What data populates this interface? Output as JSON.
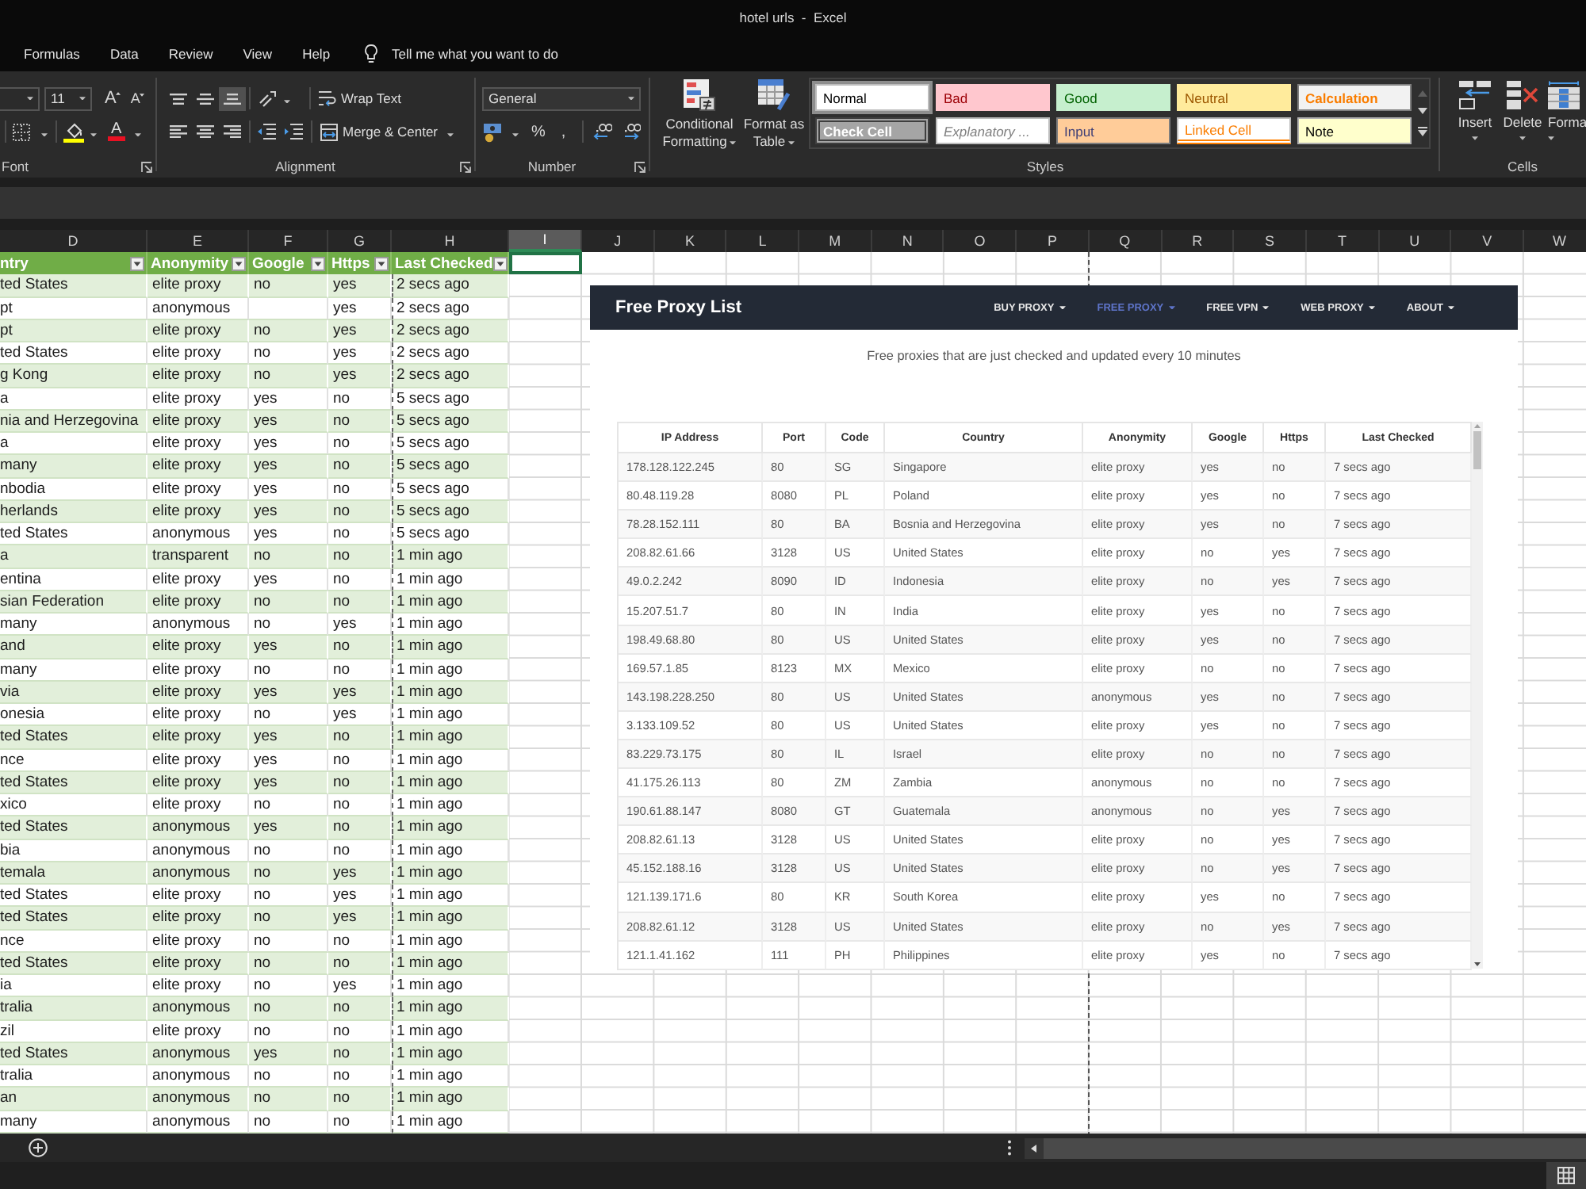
{
  "window": {
    "title": "hotel urls  -  Excel"
  },
  "ribbon": {
    "tabs": [
      "Formulas",
      "Data",
      "Review",
      "View",
      "Help"
    ],
    "tell_me": "Tell me what you want to do",
    "font": {
      "size": "11",
      "grow": "A",
      "shrink": "A",
      "font_color": "A",
      "label": "Font"
    },
    "alignment": {
      "buttons": [
        {
          "kind": "top",
          "selected": false
        },
        {
          "kind": "middle",
          "selected": false
        },
        {
          "kind": "bottom",
          "selected": true
        },
        {
          "kind": "left",
          "selected": false
        },
        {
          "kind": "center",
          "selected": false
        },
        {
          "kind": "right",
          "selected": false
        }
      ],
      "wrap_text": "Wrap Text",
      "merge": "Merge & Center",
      "label": "Alignment"
    },
    "number": {
      "format": "General",
      "percent": "%",
      "comma": ",",
      "label": "Number"
    },
    "styles": {
      "conditional_formatting": "Conditional Formatting",
      "format_as_table": "Format as Table",
      "gallery": [
        {
          "label": "Normal",
          "kind": "normal",
          "selected": true
        },
        {
          "label": "Bad",
          "kind": "bad",
          "selected": false
        },
        {
          "label": "Good",
          "kind": "good",
          "selected": false
        },
        {
          "label": "Neutral",
          "kind": "neutral",
          "selected": false
        },
        {
          "label": "Calculation",
          "kind": "calculation",
          "selected": false
        },
        {
          "label": "Check Cell",
          "kind": "check",
          "selected": false
        },
        {
          "label": "Explanatory ...",
          "kind": "explanatory",
          "selected": false
        },
        {
          "label": "Input",
          "kind": "input",
          "selected": false
        },
        {
          "label": "Linked Cell",
          "kind": "linked",
          "selected": false
        },
        {
          "label": "Note",
          "kind": "note",
          "selected": false
        }
      ],
      "label": "Styles"
    },
    "cells": {
      "buttons": [
        {
          "kind": "insert",
          "label": "Insert"
        },
        {
          "kind": "delete",
          "label": "Delete"
        },
        {
          "kind": "format",
          "label": "Forma"
        }
      ],
      "label": "Cells"
    }
  },
  "sheet": {
    "columns": [
      {
        "label": "D",
        "selected": false
      },
      {
        "label": "E",
        "selected": false
      },
      {
        "label": "F",
        "selected": false
      },
      {
        "label": "G",
        "selected": false
      },
      {
        "label": "H",
        "selected": false
      },
      {
        "label": "I",
        "selected": true
      },
      {
        "label": "J",
        "selected": false
      },
      {
        "label": "K",
        "selected": false
      },
      {
        "label": "L",
        "selected": false
      },
      {
        "label": "M",
        "selected": false
      },
      {
        "label": "N",
        "selected": false
      },
      {
        "label": "O",
        "selected": false
      },
      {
        "label": "P",
        "selected": false
      },
      {
        "label": "Q",
        "selected": false
      },
      {
        "label": "R",
        "selected": false
      },
      {
        "label": "S",
        "selected": false
      },
      {
        "label": "T",
        "selected": false
      },
      {
        "label": "U",
        "selected": false
      },
      {
        "label": "V",
        "selected": false
      },
      {
        "label": "W",
        "selected": false
      }
    ],
    "table": {
      "headers": [
        "ntry",
        "Anonymity",
        "Google",
        "Https",
        "Last Checked"
      ],
      "rows": [
        [
          "ted States",
          "elite proxy",
          "no",
          "yes",
          "2 secs ago"
        ],
        [
          "pt",
          "anonymous",
          null,
          "yes",
          "2 secs ago"
        ],
        [
          "pt",
          "elite proxy",
          "no",
          "yes",
          "2 secs ago"
        ],
        [
          "ted States",
          "elite proxy",
          "no",
          "yes",
          "2 secs ago"
        ],
        [
          "g Kong",
          "elite proxy",
          "no",
          "yes",
          "2 secs ago"
        ],
        [
          "a",
          "elite proxy",
          "yes",
          "no",
          "5 secs ago"
        ],
        [
          "nia and Herzegovina",
          "elite proxy",
          "yes",
          "no",
          "5 secs ago"
        ],
        [
          "a",
          "elite proxy",
          "yes",
          "no",
          "5 secs ago"
        ],
        [
          "many",
          "elite proxy",
          "yes",
          "no",
          "5 secs ago"
        ],
        [
          "nbodia",
          "elite proxy",
          "yes",
          "no",
          "5 secs ago"
        ],
        [
          "herlands",
          "elite proxy",
          "yes",
          "no",
          "5 secs ago"
        ],
        [
          "ted States",
          "anonymous",
          "yes",
          "no",
          "5 secs ago"
        ],
        [
          "a",
          "transparent",
          "no",
          "no",
          "1 min ago"
        ],
        [
          "entina",
          "elite proxy",
          "yes",
          "no",
          "1 min ago"
        ],
        [
          "sian Federation",
          "elite proxy",
          "no",
          "no",
          "1 min ago"
        ],
        [
          "many",
          "anonymous",
          "no",
          "yes",
          "1 min ago"
        ],
        [
          "and",
          "elite proxy",
          "yes",
          "no",
          "1 min ago"
        ],
        [
          "many",
          "elite proxy",
          "no",
          "no",
          "1 min ago"
        ],
        [
          "via",
          "elite proxy",
          "yes",
          "yes",
          "1 min ago"
        ],
        [
          "onesia",
          "elite proxy",
          "no",
          "yes",
          "1 min ago"
        ],
        [
          "ted States",
          "elite proxy",
          "yes",
          "no",
          "1 min ago"
        ],
        [
          "nce",
          "elite proxy",
          "yes",
          "no",
          "1 min ago"
        ],
        [
          "ted States",
          "elite proxy",
          "yes",
          "no",
          "1 min ago"
        ],
        [
          "xico",
          "elite proxy",
          "no",
          "no",
          "1 min ago"
        ],
        [
          "ted States",
          "anonymous",
          "yes",
          "no",
          "1 min ago"
        ],
        [
          "bia",
          "anonymous",
          "no",
          "no",
          "1 min ago"
        ],
        [
          "temala",
          "anonymous",
          "no",
          "yes",
          "1 min ago"
        ],
        [
          "ted States",
          "elite proxy",
          "no",
          "yes",
          "1 min ago"
        ],
        [
          "ted States",
          "elite proxy",
          "no",
          "yes",
          "1 min ago"
        ],
        [
          "nce",
          "elite proxy",
          "no",
          "no",
          "1 min ago"
        ],
        [
          "ted States",
          "elite proxy",
          "no",
          "no",
          "1 min ago"
        ],
        [
          "ia",
          "elite proxy",
          "no",
          "yes",
          "1 min ago"
        ],
        [
          "tralia",
          "anonymous",
          "no",
          "no",
          "1 min ago"
        ],
        [
          "zil",
          "elite proxy",
          "no",
          "no",
          "1 min ago"
        ],
        [
          "ted States",
          "anonymous",
          "yes",
          "no",
          "1 min ago"
        ],
        [
          "tralia",
          "anonymous",
          "no",
          "no",
          "1 min ago"
        ],
        [
          "an",
          "anonymous",
          "no",
          "no",
          "1 min ago"
        ],
        [
          "many",
          "anonymous",
          "no",
          "no",
          "1 min ago"
        ]
      ]
    }
  },
  "web_page": {
    "brand": "Free Proxy List",
    "nav": [
      {
        "label": "BUY PROXY",
        "selected": false
      },
      {
        "label": "FREE PROXY",
        "selected": true
      },
      {
        "label": "FREE VPN",
        "selected": false
      },
      {
        "label": "WEB PROXY",
        "selected": false
      },
      {
        "label": "ABOUT",
        "selected": false
      }
    ],
    "subtitle": "Free proxies that are just checked and updated every 10 minutes",
    "table": {
      "columns": [
        "IP Address",
        "Port",
        "Code",
        "Country",
        "Anonymity",
        "Google",
        "Https",
        "Last Checked"
      ],
      "rows": [
        [
          "178.128.122.245",
          "80",
          "SG",
          "Singapore",
          "elite proxy",
          "yes",
          "no",
          "7 secs ago"
        ],
        [
          "80.48.119.28",
          "8080",
          "PL",
          "Poland",
          "elite proxy",
          "yes",
          "no",
          "7 secs ago"
        ],
        [
          "78.28.152.111",
          "80",
          "BA",
          "Bosnia and Herzegovina",
          "elite proxy",
          "yes",
          "no",
          "7 secs ago"
        ],
        [
          "208.82.61.66",
          "3128",
          "US",
          "United States",
          "elite proxy",
          "no",
          "yes",
          "7 secs ago"
        ],
        [
          "49.0.2.242",
          "8090",
          "ID",
          "Indonesia",
          "elite proxy",
          "no",
          "yes",
          "7 secs ago"
        ],
        [
          "15.207.51.7",
          "80",
          "IN",
          "India",
          "elite proxy",
          "yes",
          "no",
          "7 secs ago"
        ],
        [
          "198.49.68.80",
          "80",
          "US",
          "United States",
          "elite proxy",
          "yes",
          "no",
          "7 secs ago"
        ],
        [
          "169.57.1.85",
          "8123",
          "MX",
          "Mexico",
          "elite proxy",
          "no",
          "no",
          "7 secs ago"
        ],
        [
          "143.198.228.250",
          "80",
          "US",
          "United States",
          "anonymous",
          "yes",
          "no",
          "7 secs ago"
        ],
        [
          "3.133.109.52",
          "80",
          "US",
          "United States",
          "elite proxy",
          "yes",
          "no",
          "7 secs ago"
        ],
        [
          "83.229.73.175",
          "80",
          "IL",
          "Israel",
          "elite proxy",
          "no",
          "no",
          "7 secs ago"
        ],
        [
          "41.175.26.113",
          "80",
          "ZM",
          "Zambia",
          "anonymous",
          "no",
          "no",
          "7 secs ago"
        ],
        [
          "190.61.88.147",
          "8080",
          "GT",
          "Guatemala",
          "anonymous",
          "no",
          "yes",
          "7 secs ago"
        ],
        [
          "208.82.61.13",
          "3128",
          "US",
          "United States",
          "elite proxy",
          "no",
          "yes",
          "7 secs ago"
        ],
        [
          "45.152.188.16",
          "3128",
          "US",
          "United States",
          "elite proxy",
          "no",
          "yes",
          "7 secs ago"
        ],
        [
          "121.139.171.6",
          "80",
          "KR",
          "South Korea",
          "elite proxy",
          "yes",
          "no",
          "7 secs ago"
        ],
        [
          "208.82.61.12",
          "3128",
          "US",
          "United States",
          "elite proxy",
          "no",
          "yes",
          "7 secs ago"
        ],
        [
          "121.1.41.162",
          "111",
          "PH",
          "Philippines",
          "elite proxy",
          "yes",
          "no",
          "7 secs ago"
        ]
      ]
    }
  }
}
